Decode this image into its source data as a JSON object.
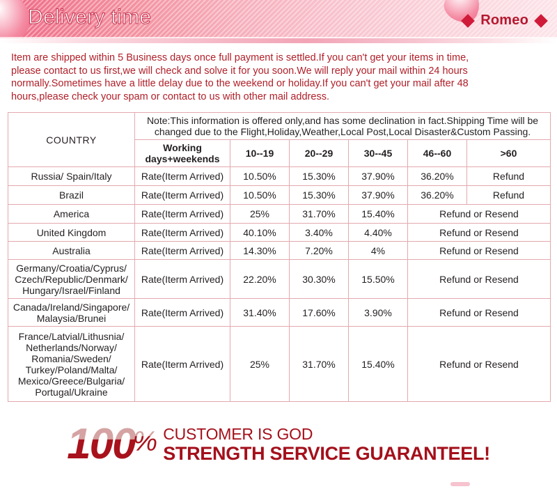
{
  "banner": {
    "title": "Delivery time",
    "brand": "Romeo",
    "left_diamond": "diamond",
    "right_diamond": "diamond"
  },
  "intro": {
    "line1": "Item are shipped within 5 Business days once full payment is settled.If you can't get your items in time,",
    "line2": "please contact to us first,we will check and solve it for you soon.We will reply your mail within 24 hours",
    "line3": "normally.Sometimes have a little delay due to the weekend or holiday.If you can't get your mail after 48",
    "line4": "hours,please check your spam or contact to us with other mail address."
  },
  "table": {
    "country_header": "COUNTRY",
    "note": "Note:This information is offered only,and has some declination in fact.Shipping Time will be changed due to the Flight,Holiday,Weather,Local Post,Local Disaster&Custom Passing.",
    "col_working": "Working\ndays+weekends",
    "ranges": [
      "10--19",
      "20--29",
      "30--45",
      "46--60",
      ">60"
    ],
    "rows": [
      {
        "country": "Russia/ Spain/Italy",
        "country_color": "red",
        "rate_label": "Rate(Iterm Arrived)",
        "v1": "10.50%",
        "v2": "15.30%",
        "v3": "37.90%",
        "v4": "36.20%",
        "v5": "Refund",
        "merged": false
      },
      {
        "country": "Brazil",
        "country_color": "red",
        "rate_label": "Rate(Iterm Arrived)",
        "v1": "10.50%",
        "v2": "15.30%",
        "v3": "37.90%",
        "v4": "36.20%",
        "v5": "Refund",
        "merged": false
      },
      {
        "country": "America",
        "country_color": "red",
        "rate_label": "Rate(Iterm Arrived)",
        "v1": "25%",
        "v2": "31.70%",
        "v3": "15.40%",
        "merged_text": "Refund or Resend",
        "merged": true
      },
      {
        "country": "United Kingdom",
        "country_color": "black",
        "rate_label": "Rate(Iterm Arrived)",
        "v1": "40.10%",
        "v2": "3.40%",
        "v3": "4.40%",
        "merged_text": "Refund or Resend",
        "merged": true
      },
      {
        "country": "Australia",
        "country_color": "black",
        "rate_label": "Rate(Iterm Arrived)",
        "v1": "14.30%",
        "v2": "7.20%",
        "v3": "4%",
        "merged_text": "Refund or Resend",
        "merged": true
      },
      {
        "country": "Germany/Croatia/Cyprus/\nCzech/Republic/Denmark/\nHungary/Israel/Finland",
        "country_color": "multi",
        "rate_label": "Rate(Iterm Arrived)",
        "v1": "22.20%",
        "v2": "30.30%",
        "v3": "15.50%",
        "merged_text": "Refund or Resend",
        "merged": true
      },
      {
        "country": "Canada/Ireland/Singapore/\nMalaysia/Brunei",
        "country_color": "multi",
        "rate_label": "Rate(Iterm Arrived)",
        "v1": "31.40%",
        "v2": "17.60%",
        "v3": "3.90%",
        "merged_text": "Refund or Resend",
        "merged": true
      },
      {
        "country": "France/Latvial/Lithusnia/\nNetherlands/Norway/\nRomania/Sweden/\nTurkey/Poland/Malta/\nMexico/Greece/Bulgaria/\nPortugal/Ukraine",
        "country_color": "multi",
        "rate_label": "Rate(Iterm Arrived)",
        "v1": "25%",
        "v2": "31.70%",
        "v3": "15.40%",
        "merged_text": "Refund or Resend",
        "merged": true
      }
    ]
  },
  "guarantee": {
    "number": "100",
    "percent": "%",
    "line1": "CUSTOMER IS GOD",
    "line2": "STRENGTH SERVICE GUARANTEEL!"
  }
}
